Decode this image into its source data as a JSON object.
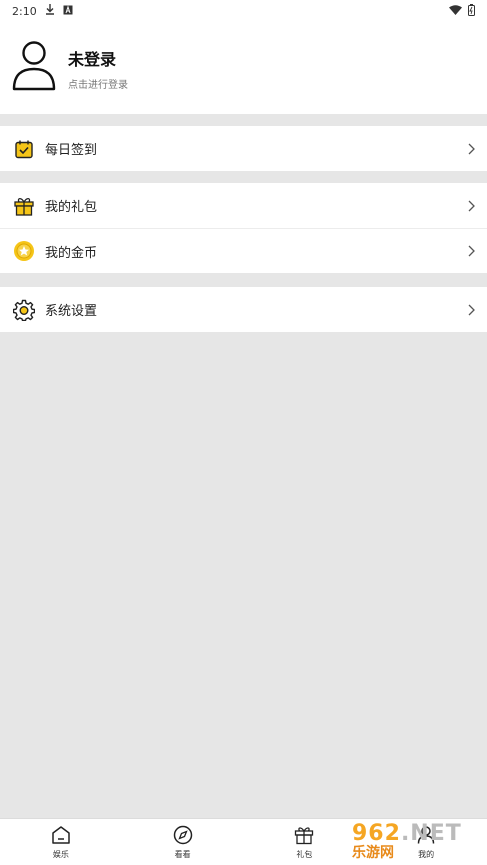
{
  "status_bar": {
    "time": "2:10",
    "icons": [
      "download-icon",
      "a-icon",
      "wifi-icon",
      "battery-icon"
    ]
  },
  "profile": {
    "name": "未登录",
    "subtitle": "点击进行登录"
  },
  "menu": {
    "checkin": "每日签到",
    "gifts": "我的礼包",
    "coins": "我的金币",
    "settings": "系统设置"
  },
  "tabbar": {
    "items": [
      {
        "label": "娱乐",
        "icon": "home-icon"
      },
      {
        "label": "看看",
        "icon": "compass-icon"
      },
      {
        "label": "礼包",
        "icon": "gift-icon"
      },
      {
        "label": "我的",
        "icon": "user-icon"
      }
    ]
  },
  "watermark": {
    "top": "962",
    "top_suffix": ".NET",
    "bottom": "乐游网"
  },
  "colors": {
    "accent": "#f5c518",
    "background": "#e6e6e6"
  }
}
